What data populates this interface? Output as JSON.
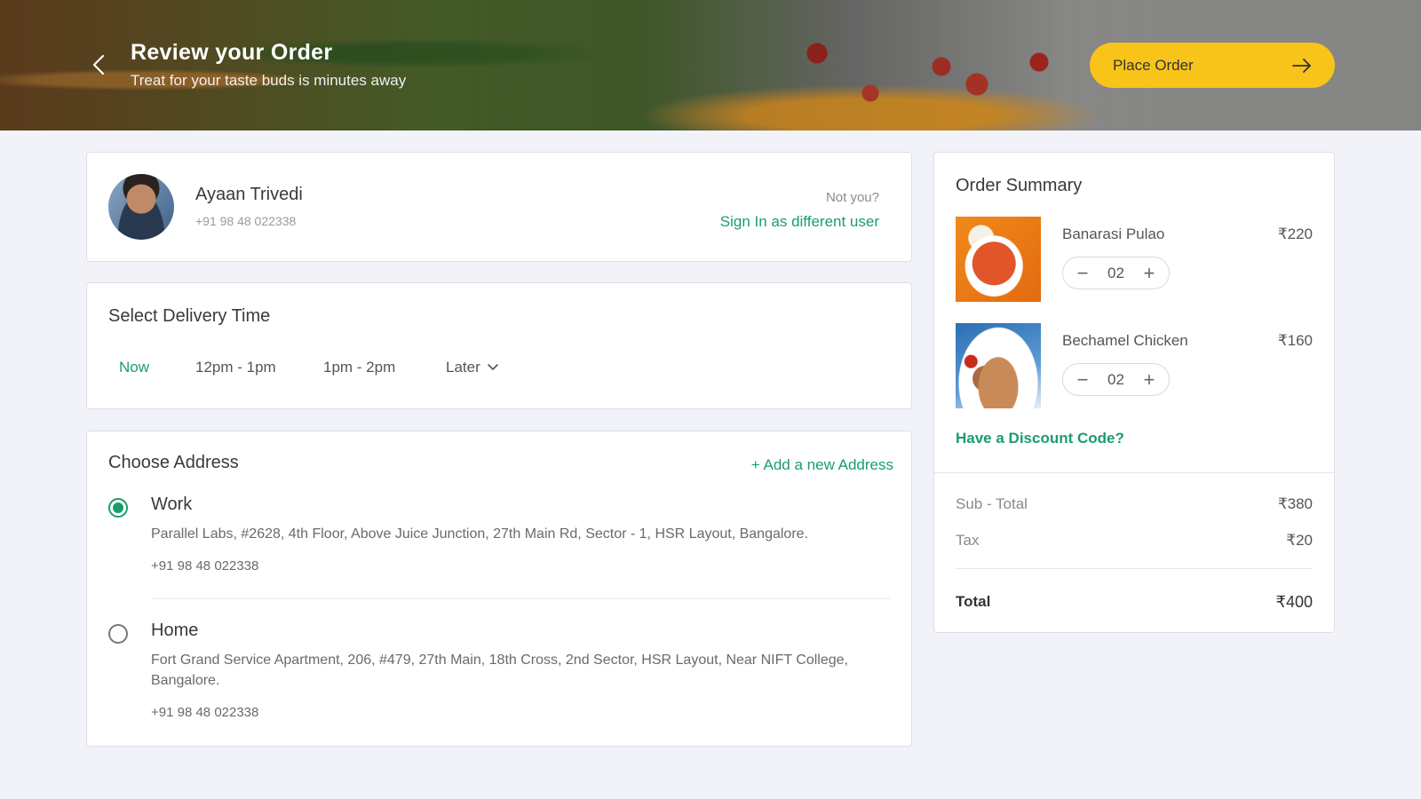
{
  "header": {
    "title": "Review your Order",
    "subtitle": "Treat for your taste buds is minutes away",
    "place_order_label": "Place Order"
  },
  "user": {
    "name": "Ayaan Trivedi",
    "phone": "+91 98 48 022338",
    "not_you": "Not you?",
    "sign_in_label": "Sign In as different user"
  },
  "delivery": {
    "title": "Select Delivery Time",
    "options": [
      "Now",
      "12pm - 1pm",
      "1pm - 2pm",
      "Later"
    ],
    "selected": "Now"
  },
  "address": {
    "title": "Choose Address",
    "add_label": "+ Add a new Address",
    "items": [
      {
        "type": "Work",
        "text": "Parallel Labs, #2628, 4th Floor, Above Juice Junction, 27th Main Rd, Sector - 1, HSR Layout,  Bangalore.",
        "phone": "+91 98 48 022338",
        "selected": true
      },
      {
        "type": "Home",
        "text": "Fort Grand Service Apartment, 206, #479, 27th Main, 18th Cross, 2nd Sector, HSR Layout, Near NIFT College, Bangalore.",
        "phone": "+91 98 48 022338",
        "selected": false
      }
    ]
  },
  "summary": {
    "title": "Order Summary",
    "items": [
      {
        "name": "Banarasi Pulao",
        "price": "₹220",
        "qty": "02"
      },
      {
        "name": "Bechamel Chicken",
        "price": "₹160",
        "qty": "02"
      }
    ],
    "discount_label": "Have a Discount Code?",
    "subtotal_label": "Sub - Total",
    "subtotal_value": "₹380",
    "tax_label": "Tax",
    "tax_value": "₹20",
    "total_label": "Total",
    "total_value": "₹400"
  },
  "colors": {
    "accent_green": "#1a9d6b",
    "button_yellow": "#f8c41a",
    "background": "#f1f3f8"
  },
  "icons": {
    "back": "back-arrow-icon",
    "arrow_right": "arrow-right-icon",
    "chevron": "chevron-down-icon"
  }
}
